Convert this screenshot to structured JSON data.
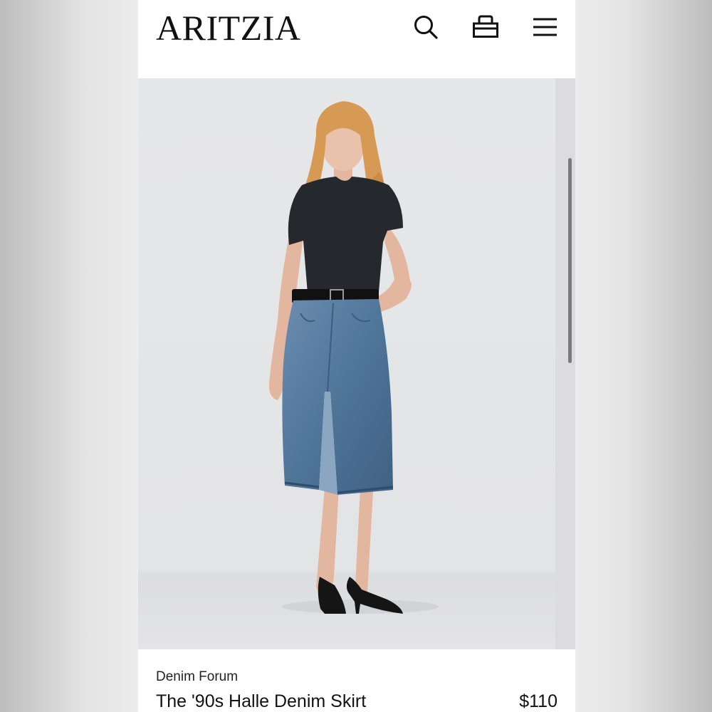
{
  "header": {
    "logo": "ARITZIA",
    "icons": {
      "search": "search-icon",
      "bag": "shopping-bag-icon",
      "menu": "hamburger-menu-icon"
    }
  },
  "product": {
    "image_alt": "Model wearing a black t-shirt, black belt, mid-length blue denim skirt with front slit, and black slingback heels",
    "brand": "Denim Forum",
    "name": "The '90s Halle Denim Skirt",
    "price": "$110"
  },
  "colors": {
    "background": "#ececec",
    "photo_bg": "#e6e7e9",
    "denim": "#5a7fa1",
    "text": "#111111"
  }
}
